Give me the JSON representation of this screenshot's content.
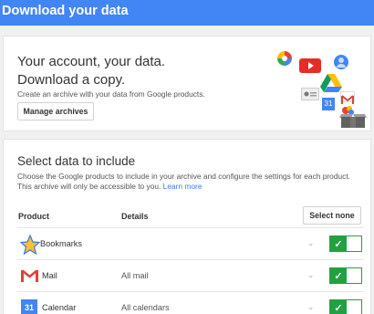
{
  "header": {
    "title": "Download your data"
  },
  "intro": {
    "headline_line1": "Your account, your data.",
    "headline_line2": "Download a copy.",
    "description": "Create an archive with your data from Google products.",
    "manage_button": "Manage archives"
  },
  "select": {
    "title": "Select data to include",
    "description_line1": "Choose the Google products to include in your archive and configure the settings for each product.",
    "description_line2": "This archive will only be accessible to you.",
    "learn_more": "Learn more",
    "col_product": "Product",
    "col_details": "Details",
    "select_none_button": "Select none"
  },
  "products": [
    {
      "name": "Bookmarks",
      "detail": "",
      "icon": "star-icon",
      "included": true
    },
    {
      "name": "Mail",
      "detail": "All mail",
      "icon": "gmail-icon",
      "included": true
    },
    {
      "name": "Calendar",
      "detail": "All calendars",
      "icon": "calendar-icon",
      "included": true
    }
  ],
  "colors": {
    "brand_blue": "#4285f4",
    "toggle_green": "#1fa23f",
    "link_blue": "#3b78e7"
  }
}
